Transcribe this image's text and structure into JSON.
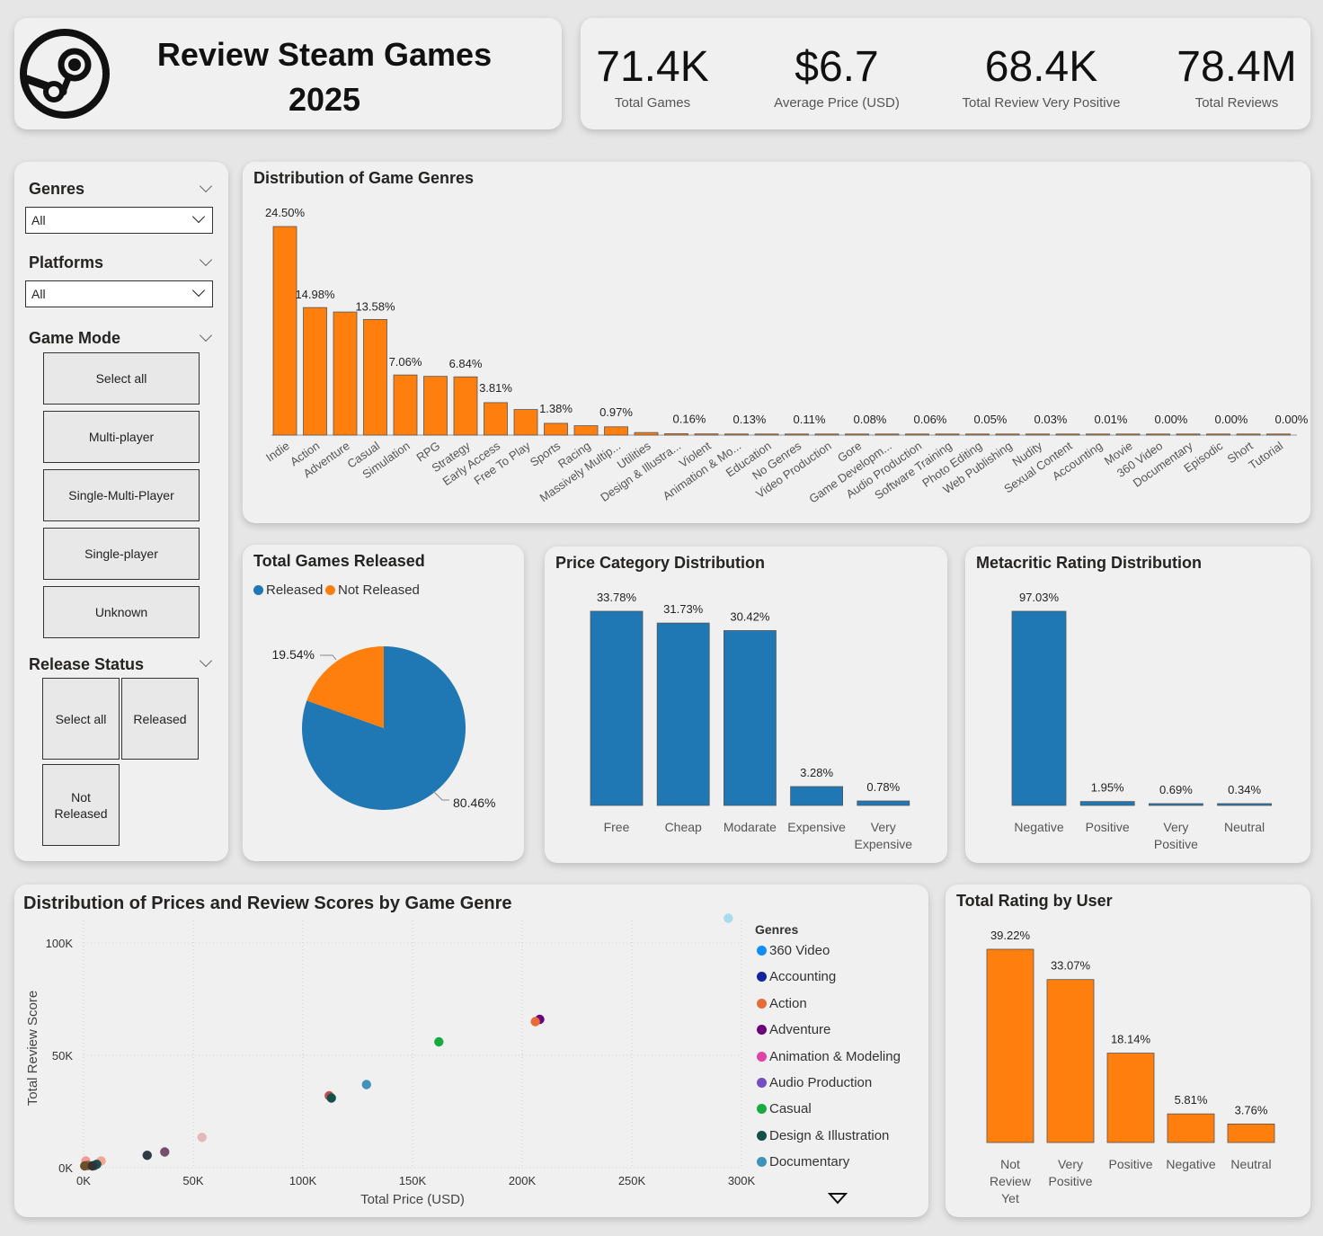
{
  "header": {
    "title_line1": "Review Steam Games",
    "title_line2": "2025",
    "logo_icon": "steam-logo-icon"
  },
  "kpis": [
    {
      "value": "71.4K",
      "label": "Total Games"
    },
    {
      "value": "$6.7",
      "label": "Average Price (USD)"
    },
    {
      "value": "68.4K",
      "label": "Total Review Very Positive"
    },
    {
      "value": "78.4M",
      "label": "Total Reviews"
    }
  ],
  "slicers": {
    "genres": {
      "label": "Genres",
      "value": "All"
    },
    "platforms": {
      "label": "Platforms",
      "value": "All"
    },
    "game_mode": {
      "label": "Game Mode",
      "options": [
        "Select all",
        "Multi-player",
        "Single-Multi-Player",
        "Single-player",
        "Unknown"
      ]
    },
    "release_status": {
      "label": "Release Status",
      "options": [
        "Select all",
        "Released",
        "Not Released"
      ]
    }
  },
  "colors": {
    "orange": "#FF7F0E",
    "blue": "#1F77B4"
  },
  "chart_data": [
    {
      "id": "genres",
      "type": "bar",
      "title": "Distribution of Game Genres",
      "categories": [
        "Indie",
        "Action",
        "Adventure",
        "Casual",
        "Simulation",
        "RPG",
        "Strategy",
        "Early Access",
        "Free To Play",
        "Sports",
        "Racing",
        "Massively Multip...",
        "Utilities",
        "Design & Illustra...",
        "Violent",
        "Animation & Mo...",
        "Education",
        "No Genres",
        "Video Production",
        "Gore",
        "Game Developm...",
        "Audio Production",
        "Software Training",
        "Photo Editing",
        "Web Publishing",
        "Nudity",
        "Sexual Content",
        "Accounting",
        "Movie",
        "360 Video",
        "Documentary",
        "Episodic",
        "Short",
        "Tutorial"
      ],
      "values": [
        24.5,
        14.98,
        14.46,
        13.58,
        7.06,
        6.9,
        6.84,
        3.81,
        3.0,
        1.38,
        1.1,
        0.97,
        0.3,
        0.16,
        0.14,
        0.13,
        0.12,
        0.11,
        0.11,
        0.08,
        0.08,
        0.08,
        0.06,
        0.05,
        0.05,
        0.05,
        0.03,
        0.02,
        0.01,
        0.01,
        0.0,
        0.0,
        0.0,
        0.0
      ],
      "data_labels": {
        "0": "24.50%",
        "1": "14.98%",
        "3": "13.58%",
        "4": "7.06%",
        "6": "6.84%",
        "7": "3.81%",
        "9": "1.38%",
        "11": "0.97%",
        "13": "0.16%",
        "15": "0.13%",
        "17": "0.11%",
        "19": "0.08%",
        "21": "0.06%",
        "23": "0.05%",
        "25": "0.03%",
        "27": "0.01%",
        "29": "0.00%",
        "31": "0.00%",
        "33": "0.00%"
      },
      "color": "#FF7F0E"
    },
    {
      "id": "released",
      "type": "pie",
      "title": "Total Games Released",
      "categories": [
        "Released",
        "Not Released"
      ],
      "values": [
        80.46,
        19.54
      ],
      "labels": [
        "80.46%",
        "19.54%"
      ],
      "colors": [
        "#1F77B4",
        "#FF7F0E"
      ],
      "legend": "top-left"
    },
    {
      "id": "price",
      "type": "bar",
      "title": "Price Category Distribution",
      "categories": [
        "Free",
        "Cheap",
        "Modarate",
        "Expensive",
        "Very Expensive"
      ],
      "values": [
        33.78,
        31.73,
        30.42,
        3.28,
        0.78
      ],
      "labels": [
        "33.78%",
        "31.73%",
        "30.42%",
        "3.28%",
        "0.78%"
      ],
      "color": "#1F77B4"
    },
    {
      "id": "metacritic",
      "type": "bar",
      "title": "Metacritic Rating Distribution",
      "categories": [
        "Negative",
        "Positive",
        "Very Positive",
        "Neutral"
      ],
      "values": [
        97.03,
        1.95,
        0.69,
        0.34
      ],
      "labels": [
        "97.03%",
        "1.95%",
        "0.69%",
        "0.34%"
      ],
      "color": "#1F77B4"
    },
    {
      "id": "scatter",
      "type": "scatter",
      "title": "Distribution of Prices and Review Scores by Game Genre",
      "xlabel": "Total Price (USD)",
      "ylabel": "Total Review Score",
      "xlim": [
        0,
        300000
      ],
      "ylim": [
        0,
        110000
      ],
      "x_ticks": [
        "0K",
        "50K",
        "100K",
        "150K",
        "200K",
        "250K",
        "300K"
      ],
      "y_ticks": [
        "0K",
        "50K",
        "100K"
      ],
      "legend_title": "Genres",
      "legend": [
        {
          "name": "360 Video",
          "color": "#118DFF"
        },
        {
          "name": "Accounting",
          "color": "#12239E"
        },
        {
          "name": "Action",
          "color": "#E66C37"
        },
        {
          "name": "Adventure",
          "color": "#6B007B"
        },
        {
          "name": "Animation & Modeling",
          "color": "#E044A7"
        },
        {
          "name": "Audio Production",
          "color": "#744EC2"
        },
        {
          "name": "Casual",
          "color": "#1AAB40"
        },
        {
          "name": "Design & Illustration",
          "color": "#15504A"
        },
        {
          "name": "Documentary",
          "color": "#4092B8"
        }
      ],
      "points": [
        {
          "x": 294000,
          "y": 111000,
          "color": "#A8DBEE"
        },
        {
          "x": 208000,
          "y": 66000,
          "color": "#6B007B"
        },
        {
          "x": 206000,
          "y": 65000,
          "color": "#E66C37"
        },
        {
          "x": 162000,
          "y": 56000,
          "color": "#1AAB40"
        },
        {
          "x": 129000,
          "y": 37000,
          "color": "#4092B8"
        },
        {
          "x": 112000,
          "y": 32000,
          "color": "#C0504D"
        },
        {
          "x": 113000,
          "y": 31000,
          "color": "#15504A"
        },
        {
          "x": 54000,
          "y": 13500,
          "color": "#E4B8BB"
        },
        {
          "x": 37000,
          "y": 7000,
          "color": "#744E6A"
        },
        {
          "x": 29000,
          "y": 5500,
          "color": "#2E3A47"
        },
        {
          "x": 8000,
          "y": 3000,
          "color": "#F2A78F"
        },
        {
          "x": 1000,
          "y": 3000,
          "color": "#F29A9A"
        },
        {
          "x": 6000,
          "y": 1500,
          "color": "#1F4E5A"
        },
        {
          "x": 5000,
          "y": 1000,
          "color": "#15504A"
        },
        {
          "x": 2000,
          "y": 1000,
          "color": "#8B5E3C"
        },
        {
          "x": 500,
          "y": 800,
          "color": "#6B4F2A"
        },
        {
          "x": 4000,
          "y": 800,
          "color": "#333333"
        }
      ]
    },
    {
      "id": "user",
      "type": "bar",
      "title": "Total Rating by User",
      "categories": [
        "Not Review Yet",
        "Very Positive",
        "Positive",
        "Negative",
        "Neutral"
      ],
      "values": [
        39.22,
        33.07,
        18.14,
        5.81,
        3.76
      ],
      "labels": [
        "39.22%",
        "33.07%",
        "18.14%",
        "5.81%",
        "3.76%"
      ],
      "color": "#FF7F0E"
    }
  ]
}
